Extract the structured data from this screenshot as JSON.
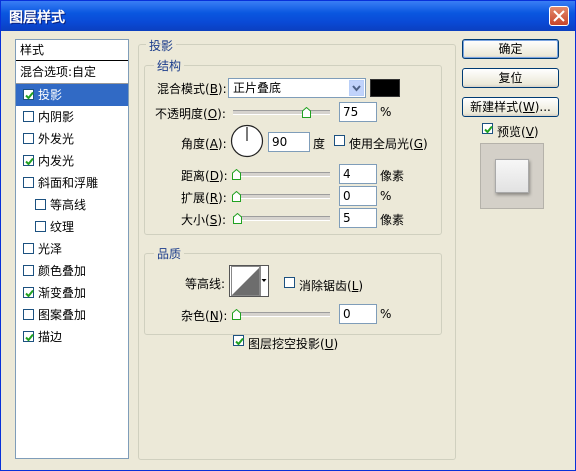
{
  "window": {
    "title": "图层样式"
  },
  "styles_panel": {
    "header": "样式",
    "blend_options": "混合选项:自定",
    "items": [
      {
        "label": "投影",
        "checked": true,
        "selected": true,
        "indent": false
      },
      {
        "label": "内阴影",
        "checked": false,
        "selected": false,
        "indent": false
      },
      {
        "label": "外发光",
        "checked": false,
        "selected": false,
        "indent": false
      },
      {
        "label": "内发光",
        "checked": true,
        "selected": false,
        "indent": false
      },
      {
        "label": "斜面和浮雕",
        "checked": false,
        "selected": false,
        "indent": false
      },
      {
        "label": "等高线",
        "checked": false,
        "selected": false,
        "indent": true
      },
      {
        "label": "纹理",
        "checked": false,
        "selected": false,
        "indent": true
      },
      {
        "label": "光泽",
        "checked": false,
        "selected": false,
        "indent": false
      },
      {
        "label": "颜色叠加",
        "checked": false,
        "selected": false,
        "indent": false
      },
      {
        "label": "渐变叠加",
        "checked": true,
        "selected": false,
        "indent": false
      },
      {
        "label": "图案叠加",
        "checked": false,
        "selected": false,
        "indent": false
      },
      {
        "label": "描边",
        "checked": true,
        "selected": false,
        "indent": false
      }
    ]
  },
  "drop_shadow": {
    "section_title": "投影",
    "structure_title": "结构",
    "blend_mode_label": "混合模式(B):",
    "blend_mode_value": "正片叠底",
    "shadow_color": "#000000",
    "opacity_label": "不透明度(O):",
    "opacity_value": "75",
    "opacity_unit": "%",
    "opacity_level": 0.75,
    "angle_label": "角度(A):",
    "angle_value": "90",
    "angle_unit": "度",
    "global_light_label": "使用全局光(G)",
    "global_light_checked": false,
    "distance_label": "距离(D):",
    "distance_value": "4",
    "distance_unit": "像素",
    "spread_label": "扩展(R):",
    "spread_value": "0",
    "spread_unit": "%",
    "size_label": "大小(S):",
    "size_value": "5",
    "size_unit": "像素",
    "quality_title": "品质",
    "contour_label": "等高线:",
    "anti_alias_label": "消除锯齿(L)",
    "anti_alias_checked": false,
    "noise_label": "杂色(N):",
    "noise_value": "0",
    "noise_unit": "%",
    "knockout_label": "图层挖空投影(U)",
    "knockout_checked": true
  },
  "buttons": {
    "ok": "确定",
    "reset": "复位",
    "new_style": "新建样式(W)...",
    "preview_label": "预览(V)",
    "preview_checked": true
  }
}
